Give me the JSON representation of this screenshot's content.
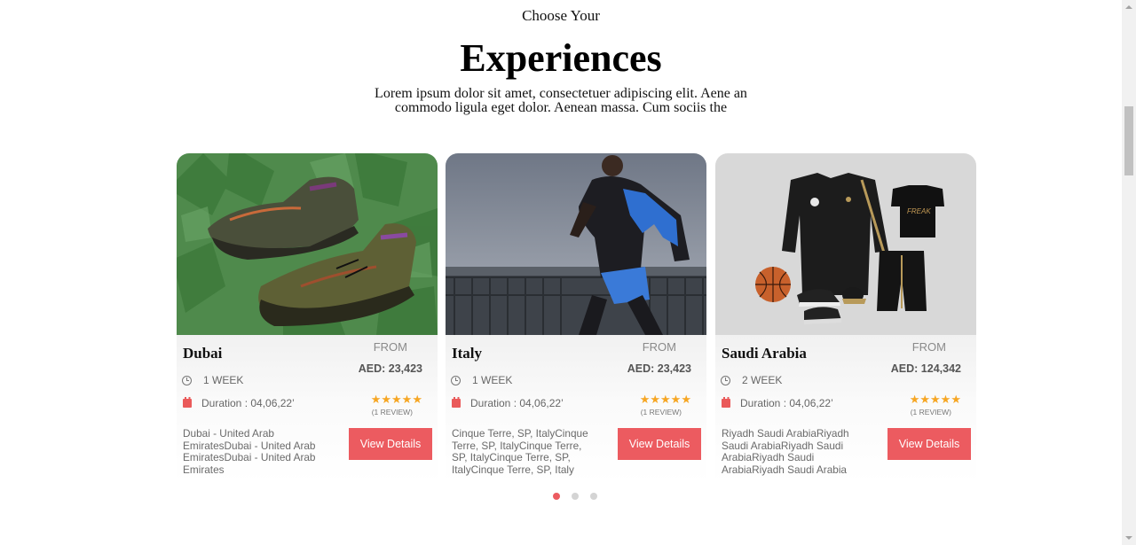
{
  "header": {
    "eyebrow": "Choose Your",
    "title": "Experiences",
    "subtitle": "Lorem ipsum dolor sit amet, consectetuer adipiscing elit. Aene an commodo ligula eget dolor. Aenean massa. Cum sociis the"
  },
  "cards": [
    {
      "name": "Dubai",
      "from_label": "FROM",
      "price": "AED: 23,423",
      "length": "1 WEEK",
      "duration": "Duration : 04,06,22’",
      "stars": "★★★★★",
      "reviews": "(1 REVIEW)",
      "location": "Dubai - United Arab EmiratesDubai - United Arab EmiratesDubai - United Arab Emirates",
      "button": "View Details",
      "image": "green sneakers on leaves"
    },
    {
      "name": "Italy",
      "from_label": "FROM",
      "price": "AED: 23,423",
      "length": "1 WEEK",
      "duration": "Duration : 04,06,22’",
      "stars": "★★★★★",
      "reviews": "(1 REVIEW)",
      "location": "Cinque Terre, SP, ItalyCinque Terre, SP, ItalyCinque Terre, SP, ItalyCinque Terre, SP, ItalyCinque Terre, SP, Italy",
      "button": "View Details",
      "image": "runner by the water"
    },
    {
      "name": "Saudi Arabia",
      "from_label": "FROM",
      "price": "AED: 124,342",
      "length": "2 WEEK",
      "duration": "Duration : 04,06,22’",
      "stars": "★★★★★",
      "reviews": "(1 REVIEW)",
      "location": "Riyadh Saudi ArabiaRiyadh Saudi ArabiaRiyadh Saudi ArabiaRiyadh Saudi ArabiaRiyadh Saudi Arabia",
      "button": "View Details",
      "image": "flat-lay sportswear and basketball"
    }
  ],
  "carousel": {
    "pages": 3,
    "active": 1
  },
  "colors": {
    "accent": "#ec5b60",
    "star": "#f6a623"
  }
}
